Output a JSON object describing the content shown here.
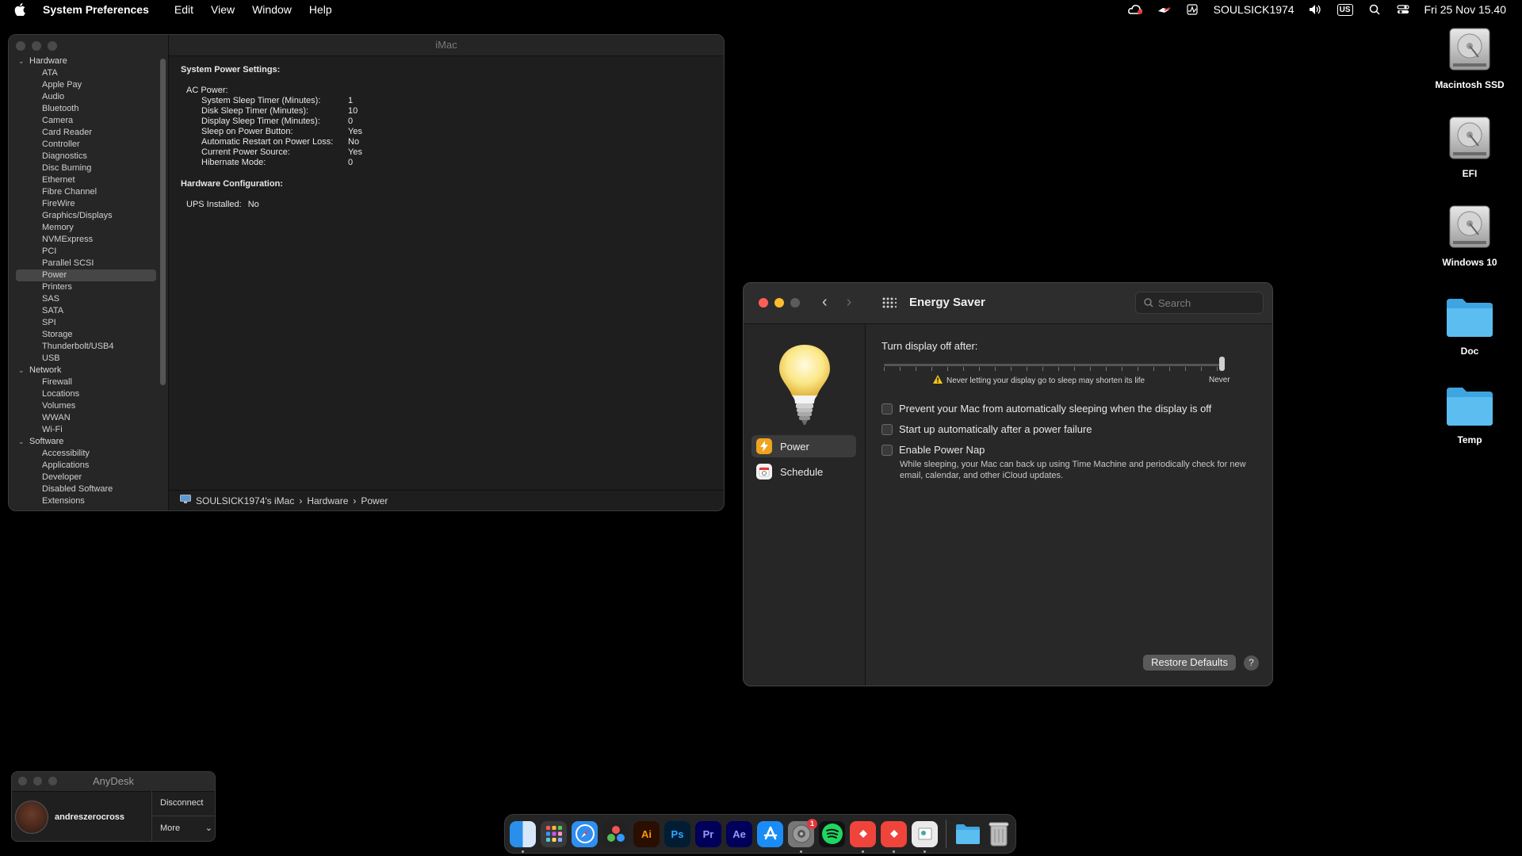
{
  "menubar": {
    "app": "System Preferences",
    "items": [
      "Edit",
      "View",
      "Window",
      "Help"
    ],
    "user": "SOULSICK1974",
    "input_source": "US",
    "datetime": "Fri 25 Nov  15.40"
  },
  "sysinfo": {
    "title": "iMac",
    "tree": [
      {
        "group": "Hardware",
        "items": [
          "ATA",
          "Apple Pay",
          "Audio",
          "Bluetooth",
          "Camera",
          "Card Reader",
          "Controller",
          "Diagnostics",
          "Disc Burning",
          "Ethernet",
          "Fibre Channel",
          "FireWire",
          "Graphics/Displays",
          "Memory",
          "NVMExpress",
          "PCI",
          "Parallel SCSI",
          "Power",
          "Printers",
          "SAS",
          "SATA",
          "SPI",
          "Storage",
          "Thunderbolt/USB4",
          "USB"
        ]
      },
      {
        "group": "Network",
        "items": [
          "Firewall",
          "Locations",
          "Volumes",
          "WWAN",
          "Wi-Fi"
        ]
      },
      {
        "group": "Software",
        "items": [
          "Accessibility",
          "Applications",
          "Developer",
          "Disabled Software",
          "Extensions"
        ]
      }
    ],
    "selected": "Power",
    "heading1": "System Power Settings:",
    "ac_power_label": "AC Power:",
    "ac_settings": [
      {
        "k": "System Sleep Timer (Minutes):",
        "v": "1"
      },
      {
        "k": "Disk Sleep Timer (Minutes):",
        "v": "10"
      },
      {
        "k": "Display Sleep Timer (Minutes):",
        "v": "0"
      },
      {
        "k": "Sleep on Power Button:",
        "v": "Yes"
      },
      {
        "k": "Automatic Restart on Power Loss:",
        "v": "No"
      },
      {
        "k": "Current Power Source:",
        "v": "Yes"
      },
      {
        "k": "Hibernate Mode:",
        "v": "0"
      }
    ],
    "heading2": "Hardware Configuration:",
    "ups_label": "UPS Installed:",
    "ups_value": "No",
    "path": [
      "SOULSICK1974's iMac",
      "Hardware",
      "Power"
    ]
  },
  "energy": {
    "title": "Energy Saver",
    "search_placeholder": "Search",
    "panes": [
      "Power",
      "Schedule"
    ],
    "slider_label": "Turn display off after:",
    "slider_value_label": "Never",
    "slider_position": 1.0,
    "warning": "Never letting your display go to sleep may shorten its life",
    "checkboxes": [
      {
        "label": "Prevent your Mac from automatically sleeping when the display is off",
        "checked": false
      },
      {
        "label": "Start up automatically after a power failure",
        "checked": false
      },
      {
        "label": "Enable Power Nap",
        "checked": false
      }
    ],
    "power_nap_desc": "While sleeping, your Mac can back up using Time Machine and periodically check for new email, calendar, and other iCloud updates.",
    "restore_button": "Restore Defaults",
    "help": "?"
  },
  "desktop": [
    "Macintosh SSD",
    "EFI",
    "Windows 10",
    "Doc",
    "Temp"
  ],
  "anydesk": {
    "title": "AnyDesk",
    "user": "andreszerocross",
    "disconnect": "Disconnect",
    "more": "More"
  },
  "dock": {
    "apps": [
      "Finder",
      "Launchpad",
      "Safari",
      "DaVinci Resolve",
      "Illustrator",
      "Photoshop",
      "Premiere Pro",
      "After Effects",
      "App Store",
      "System Preferences",
      "Spotify",
      "AnyDesk",
      "AnyDesk Alt",
      "Preview",
      "Downloads",
      "Trash"
    ],
    "labels": {
      "ai": "Ai",
      "ps": "Ps",
      "pr": "Pr",
      "ae": "Ae"
    },
    "badge": "1"
  },
  "colors": {
    "close": "#ff5f57",
    "minimize": "#febc2e",
    "zoom": "#5c5c5c",
    "power_icon": "#f0a31c",
    "folder": "#4fb4ec"
  }
}
